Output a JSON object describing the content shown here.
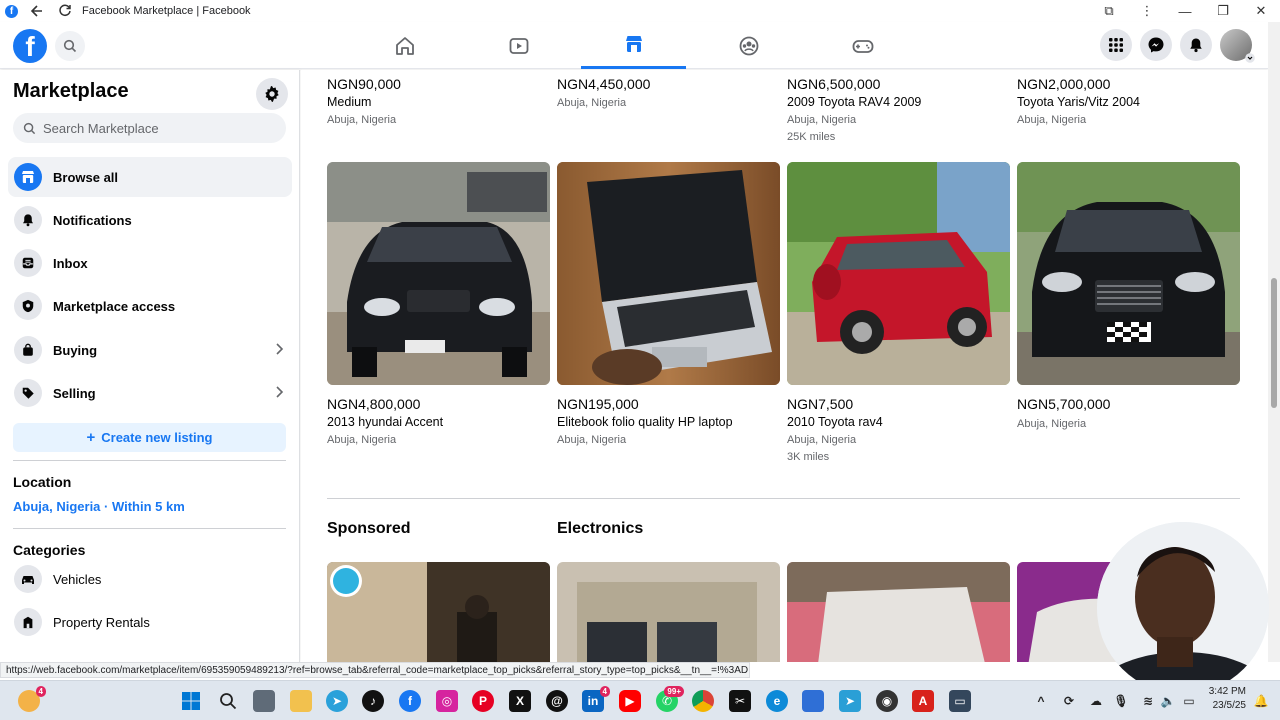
{
  "browser": {
    "window_title": "Facebook Marketplace | Facebook",
    "status_url": "https://web.facebook.com/marketplace/item/695359059489213/?ref=browse_tab&referral_code=marketplace_top_picks&referral_story_type=top_picks&__tn__=!%3AD"
  },
  "header": {
    "logo_letter": "f",
    "nav_tabs": [
      {
        "name": "home-icon"
      },
      {
        "name": "video-icon"
      },
      {
        "name": "marketplace-icon",
        "active": true
      },
      {
        "name": "groups-icon"
      },
      {
        "name": "gaming-icon"
      }
    ]
  },
  "sidebar": {
    "title": "Marketplace",
    "search_placeholder": "Search Marketplace",
    "items": [
      {
        "label": "Browse all",
        "icon": "storefront-icon",
        "active": true
      },
      {
        "label": "Notifications",
        "icon": "bell-icon"
      },
      {
        "label": "Inbox",
        "icon": "inbox-icon"
      },
      {
        "label": "Marketplace access",
        "icon": "shield-icon"
      },
      {
        "label": "Buying",
        "icon": "bag-icon",
        "chevron": true
      },
      {
        "label": "Selling",
        "icon": "tag-icon",
        "chevron": true
      }
    ],
    "create_listing": "Create new listing",
    "location_heading": "Location",
    "location_value": "Abuja, Nigeria · Within 5 km",
    "categories_heading": "Categories",
    "categories": [
      {
        "label": "Vehicles",
        "icon": "car-icon"
      },
      {
        "label": "Property Rentals",
        "icon": "house-icon"
      }
    ]
  },
  "listings_top": [
    {
      "price": "NGN90,000",
      "title": "Medium",
      "location": "Abuja, Nigeria",
      "extra": ""
    },
    {
      "price": "NGN4,450,000",
      "title": "",
      "location": "Abuja, Nigeria",
      "extra": ""
    },
    {
      "price": "NGN6,500,000",
      "title": "2009 Toyota RAV4 2009",
      "location": "Abuja, Nigeria",
      "extra": "25K miles"
    },
    {
      "price": "NGN2,000,000",
      "title": "Toyota Yaris/Vitz 2004",
      "location": "Abuja, Nigeria",
      "extra": ""
    }
  ],
  "listings": [
    {
      "price": "NGN4,800,000",
      "title": "2013 hyundai Accent",
      "location": "Abuja, Nigeria",
      "extra": "",
      "image": "black-sedan"
    },
    {
      "price": "NGN195,000",
      "title": "Elitebook folio quality HP laptop",
      "location": "Abuja, Nigeria",
      "extra": "",
      "image": "laptop"
    },
    {
      "price": "NGN7,500",
      "title": "2010 Toyota rav4",
      "location": "Abuja, Nigeria",
      "extra": "3K miles",
      "image": "red-suv"
    },
    {
      "price": "NGN5,700,000",
      "title": "",
      "location": "Abuja, Nigeria",
      "extra": "",
      "image": "black-mercedes"
    }
  ],
  "sections": {
    "sponsored": "Sponsored",
    "electronics": "Electronics"
  },
  "taskbar": {
    "time": "3:42 PM",
    "date": "23/5/25",
    "badges": {
      "linkedin": "4",
      "youtube": "99+",
      "weather": "4"
    }
  },
  "colors": {
    "accent": "#1877f2",
    "text_secondary": "#65676b"
  }
}
